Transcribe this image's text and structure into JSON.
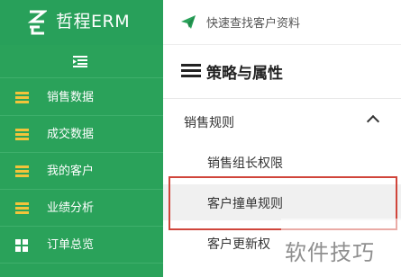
{
  "app": {
    "brand": "哲程ERM"
  },
  "topbar": {
    "quick_search": "快速查找客户资料"
  },
  "sidebar": {
    "items": [
      {
        "label": "销售数据",
        "icon": "lines-icon"
      },
      {
        "label": "成交数据",
        "icon": "lines-icon"
      },
      {
        "label": "我的客户",
        "icon": "lines-icon"
      },
      {
        "label": "业绩分析",
        "icon": "lines-icon"
      },
      {
        "label": "订单总览",
        "icon": "grid-icon"
      }
    ]
  },
  "panel": {
    "title": "策略与属性",
    "group": {
      "label": "销售规则",
      "expanded": true
    },
    "sub_items": [
      {
        "label": "销售组长权限",
        "active": false
      },
      {
        "label": "客户撞单规则",
        "active": true
      },
      {
        "label": "客户更新权",
        "active": false
      }
    ]
  },
  "watermark": {
    "text": "软件技巧"
  },
  "colors": {
    "sidebar": "#2aa25a",
    "accent_icon": "#f3c43a",
    "highlight": "#d0453b",
    "active_row": "#f0f0f0"
  }
}
